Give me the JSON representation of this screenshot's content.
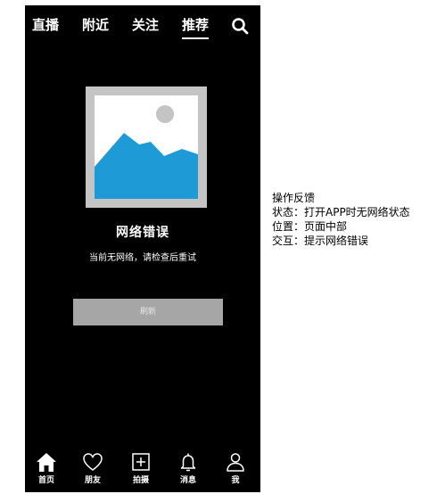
{
  "top_nav": {
    "tabs": [
      {
        "label": "直播"
      },
      {
        "label": "附近"
      },
      {
        "label": "关注"
      },
      {
        "label": "推荐",
        "active": true
      }
    ],
    "search_icon": "search-icon"
  },
  "error_state": {
    "image_icon": "image-placeholder-icon",
    "title": "网络错误",
    "description": "当前无网络，请检查后重试",
    "refresh_label": "刷新"
  },
  "bottom_nav": {
    "items": [
      {
        "label": "首页",
        "icon": "home-icon"
      },
      {
        "label": "朋友",
        "icon": "heart-icon"
      },
      {
        "label": "拍摄",
        "icon": "plus-icon"
      },
      {
        "label": "消息",
        "icon": "bell-icon"
      },
      {
        "label": "我",
        "icon": "user-icon"
      }
    ]
  },
  "annotation": {
    "heading": "操作反馈",
    "state": "状态：打开APP时无网络状态",
    "position": "位置：页面中部",
    "interaction": "交互：提示网络错误"
  },
  "colors": {
    "phone_background": "#000000",
    "image_frame": "#c4c4c4",
    "image_mountain": "#1e9bd7",
    "image_sun": "#c4c4c4",
    "button_background": "#a6a6a6"
  }
}
